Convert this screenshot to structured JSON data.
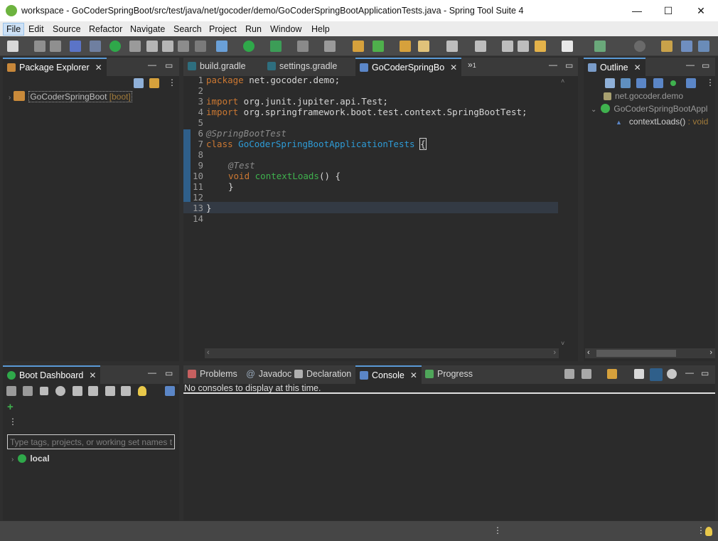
{
  "window": {
    "title": "workspace - GoCoderSpringBoot/src/test/java/net/gocoder/demo/GoCoderSpringBootApplicationTests.java - Spring Tool Suite 4",
    "minimize": "—",
    "maximize": "☐",
    "close": "✕"
  },
  "menu": {
    "file": "File",
    "edit": "Edit",
    "source": "Source",
    "refactor": "Refactor",
    "navigate": "Navigate",
    "search": "Search",
    "project": "Project",
    "run": "Run",
    "window": "Window",
    "help": "Help"
  },
  "package_explorer": {
    "tab_label": "Package Explorer",
    "project_name": "GoCoderSpringBoot",
    "project_tag": "[boot]"
  },
  "editor": {
    "tabs": [
      "build.gradle",
      "settings.gradle",
      "GoCoderSpringBo"
    ],
    "overflow": "»",
    "overflow_count": "1",
    "lines": [
      "1",
      "2",
      "3",
      "4",
      "5",
      "6",
      "7",
      "8",
      "9",
      "10",
      "11",
      "12",
      "13",
      "14"
    ],
    "code": {
      "l1_kw": "package",
      "l1_rest": " net.gocoder.demo;",
      "l3_kw": "import",
      "l3_rest": " org.junit.jupiter.api.Test;",
      "l4_kw": "import",
      "l4_rest": " org.springframework.boot.test.context.SpringBootTest;",
      "l6_ann": "@SpringBootTest",
      "l7_kw": "class",
      "l7_cls": "GoCoderSpringBootApplicationTests",
      "l7_brace": "{",
      "l9_ann": "@Test",
      "l10_kw": "void",
      "l10_mth": "contextLoads",
      "l10_rest": "() {",
      "l11": "}",
      "l13": "}"
    }
  },
  "outline": {
    "tab_label": "Outline",
    "package": "net.gocoder.demo",
    "class_name": "GoCoderSpringBootAppl",
    "method": "contextLoads()",
    "method_type": " : void"
  },
  "boot_dashboard": {
    "tab_label": "Boot Dashboard",
    "filter_placeholder": "Type tags, projects, or working set names t",
    "local": "local"
  },
  "bottom_panel": {
    "tabs": [
      "Problems",
      "Javadoc",
      "Declaration",
      "Console",
      "Progress"
    ],
    "console_message": "No consoles to display at this time."
  },
  "colors": {
    "keyword": "#cc7832",
    "class": "#2e9bd6",
    "method": "#3fb14e",
    "annotation": "#8a8a8a",
    "accent": "#5a9ad6"
  }
}
